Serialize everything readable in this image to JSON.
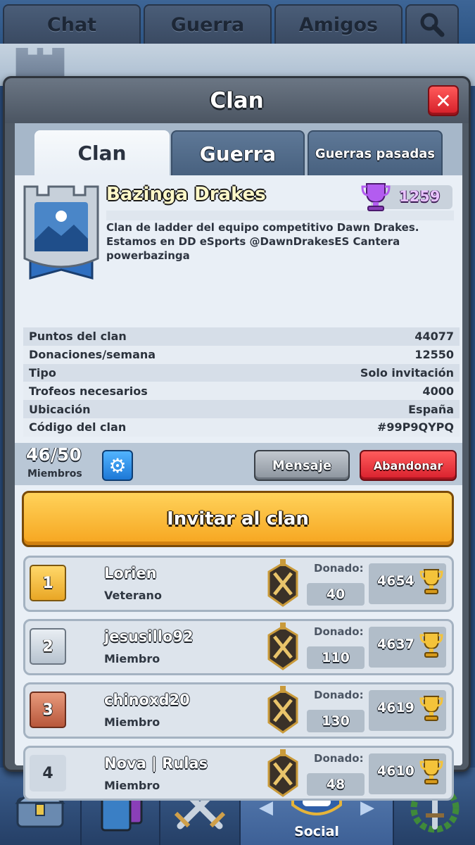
{
  "top_tabs": [
    "Chat",
    "Guerra",
    "Amigos"
  ],
  "dialog": {
    "title": "Clan",
    "tabs": [
      "Clan",
      "Guerra",
      "Guerras pasadas"
    ]
  },
  "clan": {
    "name": "Bazinga Drakes",
    "trophies": "1259",
    "description": "Clan de ladder del equipo competitivo Dawn Drakes. Estamos en DD eSports @DawnDrakesES Cantera powerbazinga",
    "stats": [
      {
        "label": "Puntos del clan",
        "value": "44077"
      },
      {
        "label": "Donaciones/semana",
        "value": "12550"
      },
      {
        "label": "Tipo",
        "value": "Solo invitación"
      },
      {
        "label": "Trofeos necesarios",
        "value": "4000"
      },
      {
        "label": "Ubicación",
        "value": "España"
      },
      {
        "label": "Código del clan",
        "value": "#99P9QYPQ"
      }
    ]
  },
  "members_bar": {
    "count": "46/50",
    "label": "Miembros",
    "message_button": "Mensaje",
    "leave_button": "Abandonar"
  },
  "invite_button": "Invitar al clan",
  "donated_label": "Donado:",
  "members": [
    {
      "rank": "1",
      "name": "Lorien",
      "role": "Veterano",
      "donated": "40",
      "trophies": "4654",
      "rank_style": "gold"
    },
    {
      "rank": "2",
      "name": "jesusillo92",
      "role": "Miembro",
      "donated": "110",
      "trophies": "4637",
      "rank_style": "silver"
    },
    {
      "rank": "3",
      "name": "chinoxd20",
      "role": "Miembro",
      "donated": "130",
      "trophies": "4619",
      "rank_style": "bronze"
    },
    {
      "rank": "4",
      "name": "Nova | Rulas",
      "role": "Miembro",
      "donated": "48",
      "trophies": "4610",
      "rank_style": "plain"
    }
  ],
  "bottom_nav": {
    "active_label": "Social",
    "icons": [
      "chest-icon",
      "cards-icon",
      "battle-icon",
      "social-icon",
      "tournament-icon"
    ]
  },
  "colors": {
    "invite": "#f6a51f",
    "leave": "#d81f2c",
    "close": "#d41e28",
    "clan_name": "#fff8c8",
    "trophy_purple": "#b35cf0"
  }
}
